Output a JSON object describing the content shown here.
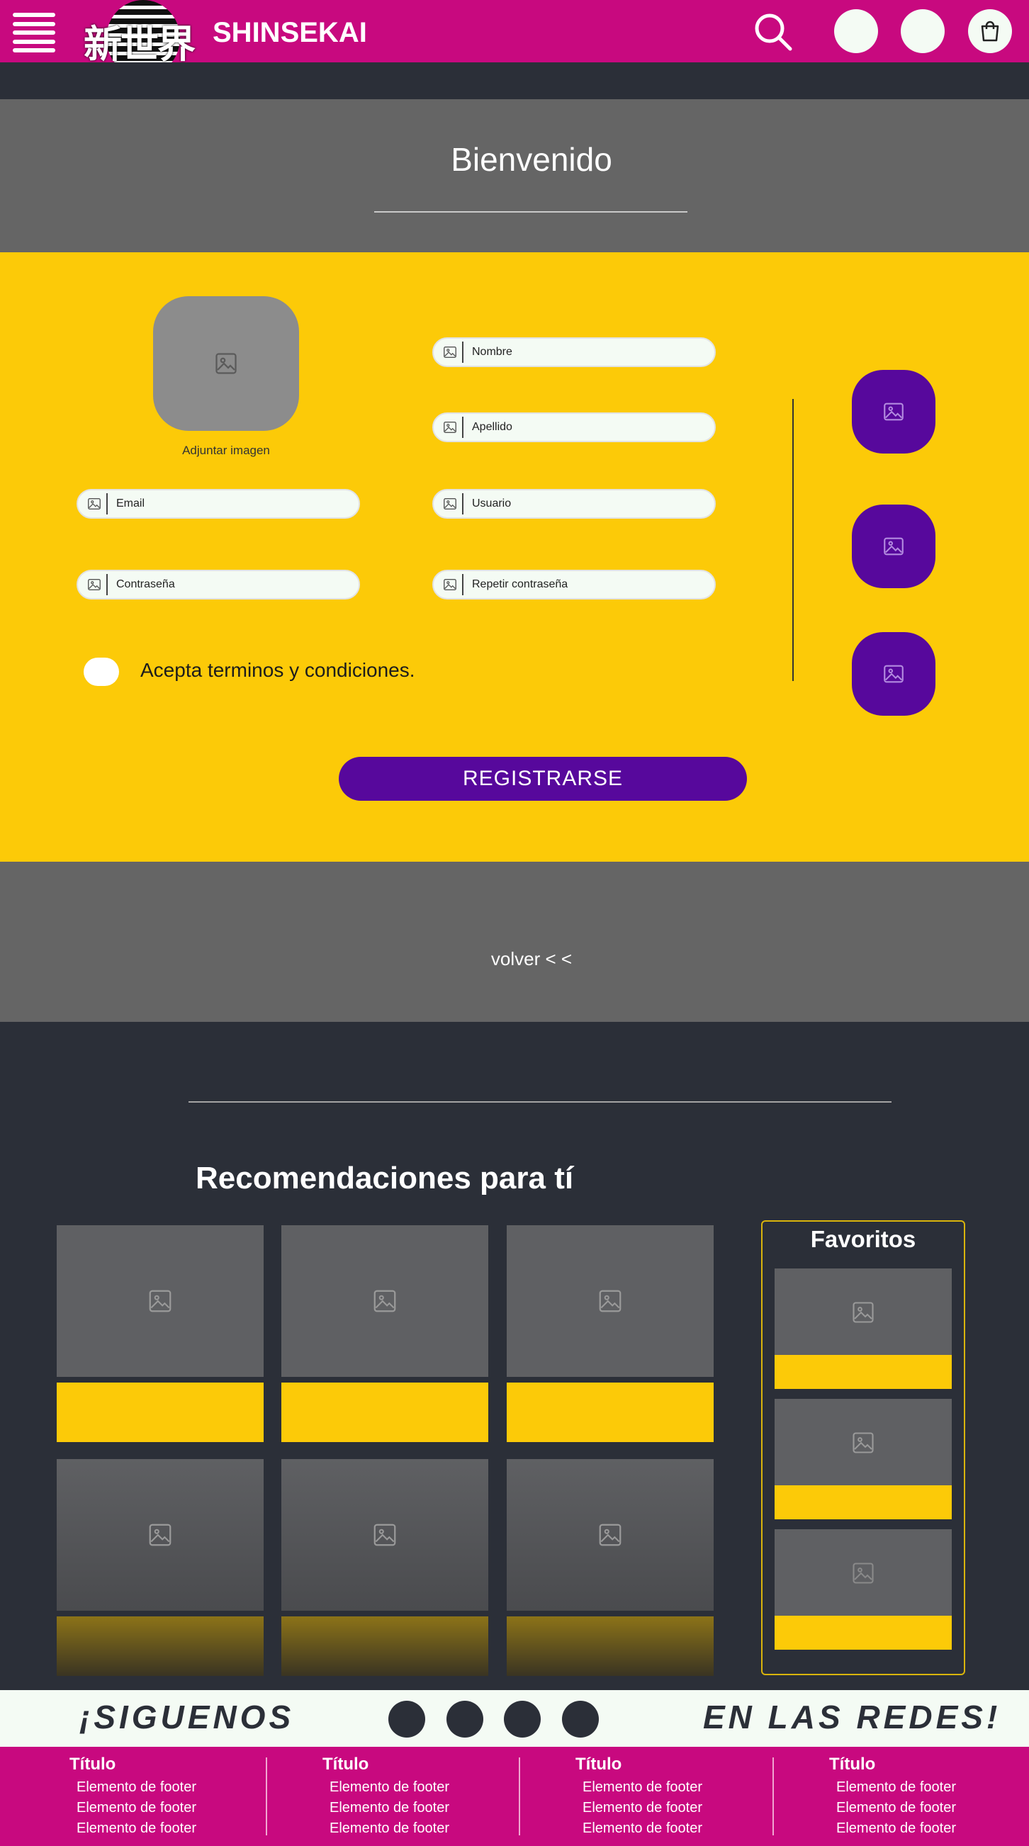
{
  "header": {
    "brand_kanji": "新世界",
    "brand_name": "SHINSEKAI",
    "icons": [
      "menu-icon",
      "search-icon",
      "user-circle-icon",
      "user-circle-icon",
      "shopping-bag-icon"
    ]
  },
  "welcome": {
    "title": "Bienvenido"
  },
  "form": {
    "attach_image_label": "Adjuntar imagen",
    "fields": {
      "nombre": "Nombre",
      "apellido": "Apellido",
      "email": "Email",
      "usuario": "Usuario",
      "contrasena": "Contraseña",
      "repetir": "Repetir contraseña"
    },
    "terms_label": "Acepta terminos y condiciones.",
    "submit_label": "REGISTRARSE"
  },
  "back": {
    "label": "volver  < <"
  },
  "recommendations": {
    "title": "Recomendaciones para tí"
  },
  "favorites": {
    "title": "Favoritos"
  },
  "social": {
    "text_left": "¡SIGUENOS",
    "text_right": "EN LAS REDES!"
  },
  "footer": {
    "columns": [
      {
        "title": "Título",
        "items": [
          "Elemento de footer",
          "Elemento de footer",
          "Elemento de footer"
        ]
      },
      {
        "title": "Título",
        "items": [
          "Elemento de footer",
          "Elemento de footer",
          "Elemento de footer"
        ]
      },
      {
        "title": "Título",
        "items": [
          "Elemento de footer",
          "Elemento de footer",
          "Elemento de footer"
        ]
      },
      {
        "title": "Título",
        "items": [
          "Elemento de footer",
          "Elemento de footer",
          "Elemento de footer"
        ]
      }
    ]
  },
  "colors": {
    "magenta": "#c8097f",
    "yellow": "#fcca08",
    "purple": "#57089c",
    "dark": "#2b2f38",
    "gray": "#656565"
  }
}
